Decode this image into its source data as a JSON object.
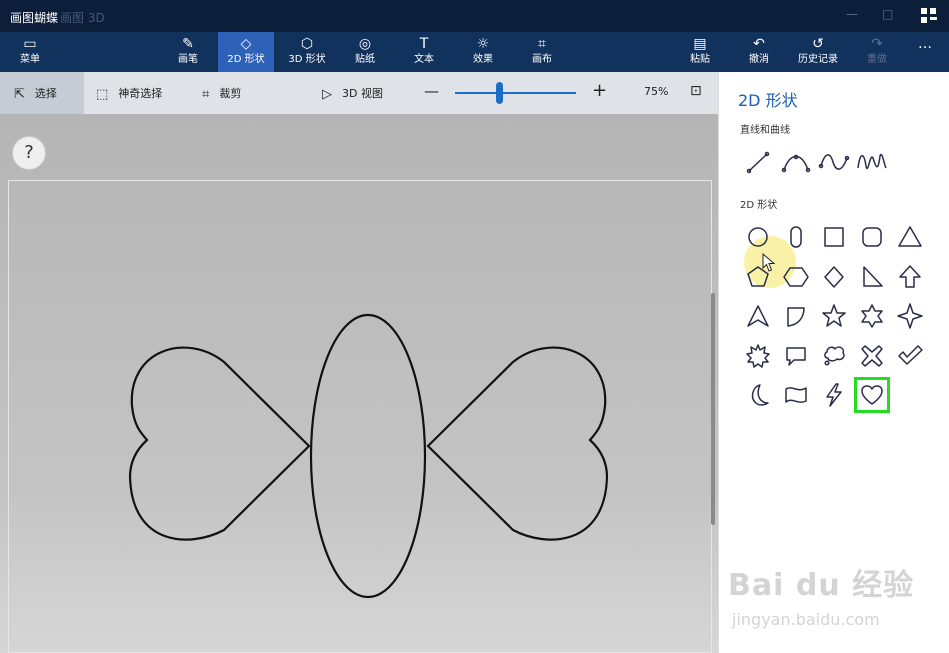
{
  "titlebar": {
    "title": "画图蝴蝶",
    "app_ghost": "画图 3D"
  },
  "ribbon": {
    "menu": "菜单",
    "brushes": "画笔",
    "shapes_2d": "2D 形状",
    "shapes_3d": "3D 形状",
    "stickers": "贴纸",
    "text": "文本",
    "effects": "效果",
    "canvas": "画布",
    "paste": "粘贴",
    "undo": "撤消",
    "history": "历史记录",
    "redo": "重做",
    "more": "…"
  },
  "toolbar": {
    "select": "选择",
    "magic_select": "神奇选择",
    "crop": "裁剪",
    "view_3d": "3D 视图",
    "zoom_out": "—",
    "zoom_in": "+",
    "zoom_level": "75%",
    "zoom_percent": 0.37
  },
  "canvas": {
    "help": "?"
  },
  "panel": {
    "title": "2D 形状",
    "lines_label": "直线和曲线",
    "shapes_label": "2D 形状",
    "line_tools": [
      "line-icon",
      "curve-icon",
      "wave-curve-icon",
      "double-wave-curve-icon"
    ],
    "shapes": [
      "circle-icon",
      "rounded-capsule-icon",
      "square-icon",
      "rounded-square-icon",
      "triangle-icon",
      "pentagon-icon",
      "hexagon-icon",
      "diamond-icon",
      "right-triangle-icon",
      "arrow-up-icon",
      "arrowhead-icon",
      "quarter-shape-icon",
      "star5-icon",
      "star6-icon",
      "star4-icon",
      "burst-icon",
      "speech-bubble-icon",
      "thought-bubble-icon",
      "cross-icon",
      "checkmark-icon",
      "moon-icon",
      "banner-icon",
      "lightning-icon",
      "heart-icon"
    ],
    "selected_shape": "heart-icon",
    "selected_color": "#22dd22"
  },
  "watermark": {
    "main": "Bai du 经验",
    "sub": "jingyan.baidu.com"
  }
}
